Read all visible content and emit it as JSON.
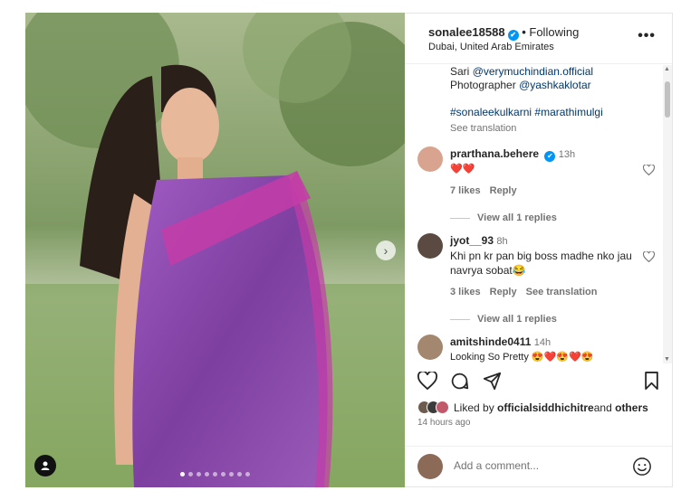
{
  "post": {
    "username": "sonalee18588",
    "verified_mark": "✔",
    "separator": "•",
    "following_label": "Following",
    "location": "Dubai, United Arab Emirates",
    "more_label": "•••",
    "image_dots": 9,
    "image_dot_active": 1
  },
  "caption": {
    "line1_prefix": "Sari ",
    "line1_mention": "@verymuchindian.official",
    "line2_prefix": "Photographer ",
    "line2_mention": "@yashkaklotar",
    "tag1": "#sonaleekulkarni",
    "tag2": "#marathimulgi",
    "see_translation": "See translation"
  },
  "comments": [
    {
      "username": "prarthana.behere",
      "verified": true,
      "time": "13h",
      "text": "❤️❤️",
      "likes": "7 likes",
      "reply": "Reply",
      "view_replies": "View all 1 replies",
      "avatar_color": "#d8a48f"
    },
    {
      "username": "jyot__93",
      "verified": false,
      "time": "8h",
      "text": "Khi pn kr pan big boss madhe nko jau navrya sobat😂",
      "likes": "3 likes",
      "reply": "Reply",
      "see_translation": "See translation",
      "view_replies": "View all 1 replies",
      "avatar_color": "#5a4a42"
    },
    {
      "username": "amitshinde0411",
      "verified": false,
      "time": "14h",
      "text": "Looking So Pretty 😍❤️😍❤️😍",
      "avatar_color": "#a3876f"
    }
  ],
  "footer": {
    "liked_by_prefix": "Liked by ",
    "liked_by_user": "officialsiddhichitre",
    "liked_by_suffix": " and ",
    "liked_by_others": "others",
    "time_ago": "14 hours ago",
    "comment_placeholder": "Add a comment..."
  },
  "colors": {
    "link": "#00376b",
    "verified": "#0095f6",
    "saree": "#8e4fb0",
    "muted": "#737373"
  }
}
